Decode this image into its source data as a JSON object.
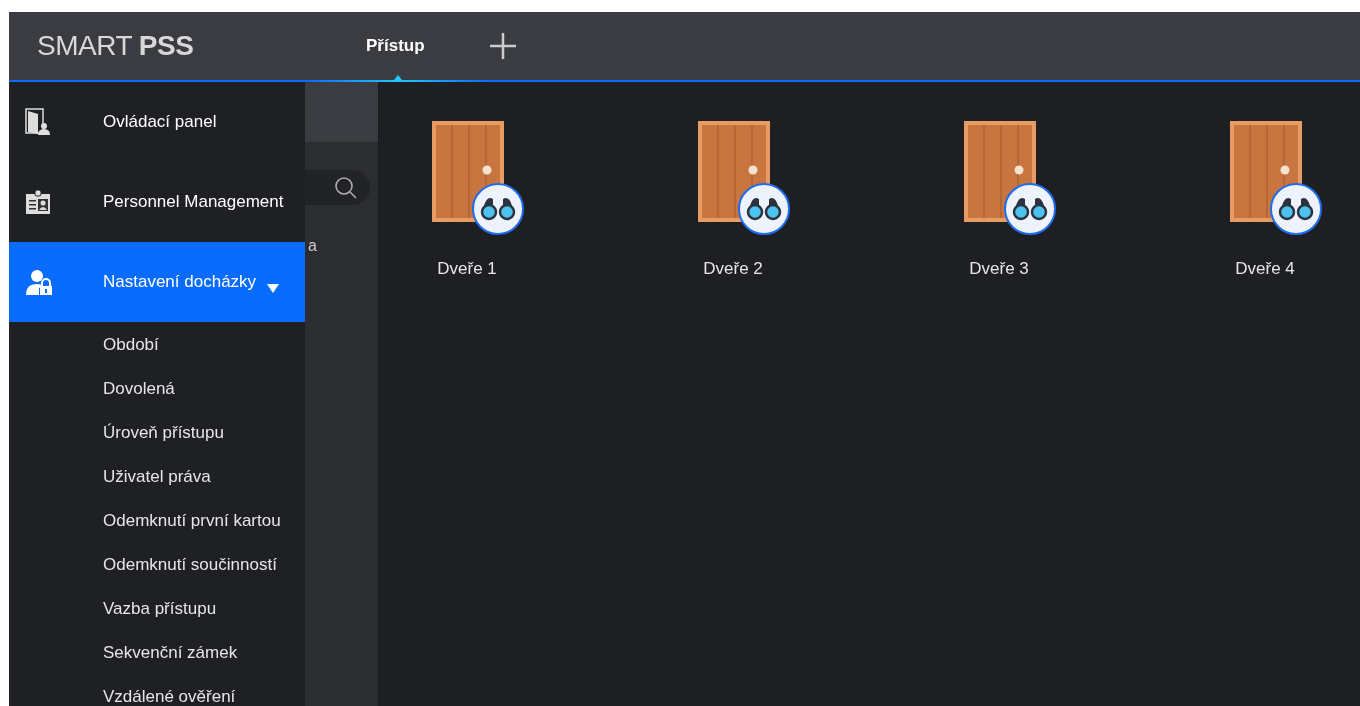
{
  "logo": {
    "light": "SMART",
    "bold": "PSS"
  },
  "tabs": [
    {
      "label": "Přístup",
      "selected": true
    }
  ],
  "menu": [
    {
      "kind": "control-panel",
      "label": "Ovládací panel",
      "selected": false
    },
    {
      "kind": "personnel",
      "label": "Personnel Management",
      "selected": false
    },
    {
      "kind": "attendance",
      "label": "Nastavení docházky",
      "selected": true,
      "expanded": true,
      "children": [
        {
          "label": "Období"
        },
        {
          "label": "Dovolená"
        },
        {
          "label": "Úroveň přístupu"
        },
        {
          "label": "Uživatel práva"
        },
        {
          "label": "Odemknutí první kartou"
        },
        {
          "label": "Odemknutí součinností"
        },
        {
          "label": "Vazba přístupu"
        },
        {
          "label": "Sekvenční zámek"
        },
        {
          "label": "Vzdálené ověření"
        }
      ]
    }
  ],
  "background_panel": {
    "partial_text": "a"
  },
  "doors": [
    {
      "label": "Dveře 1"
    },
    {
      "label": "Dveře 2"
    },
    {
      "label": "Dveře 3"
    },
    {
      "label": "Dveře 4"
    }
  ]
}
